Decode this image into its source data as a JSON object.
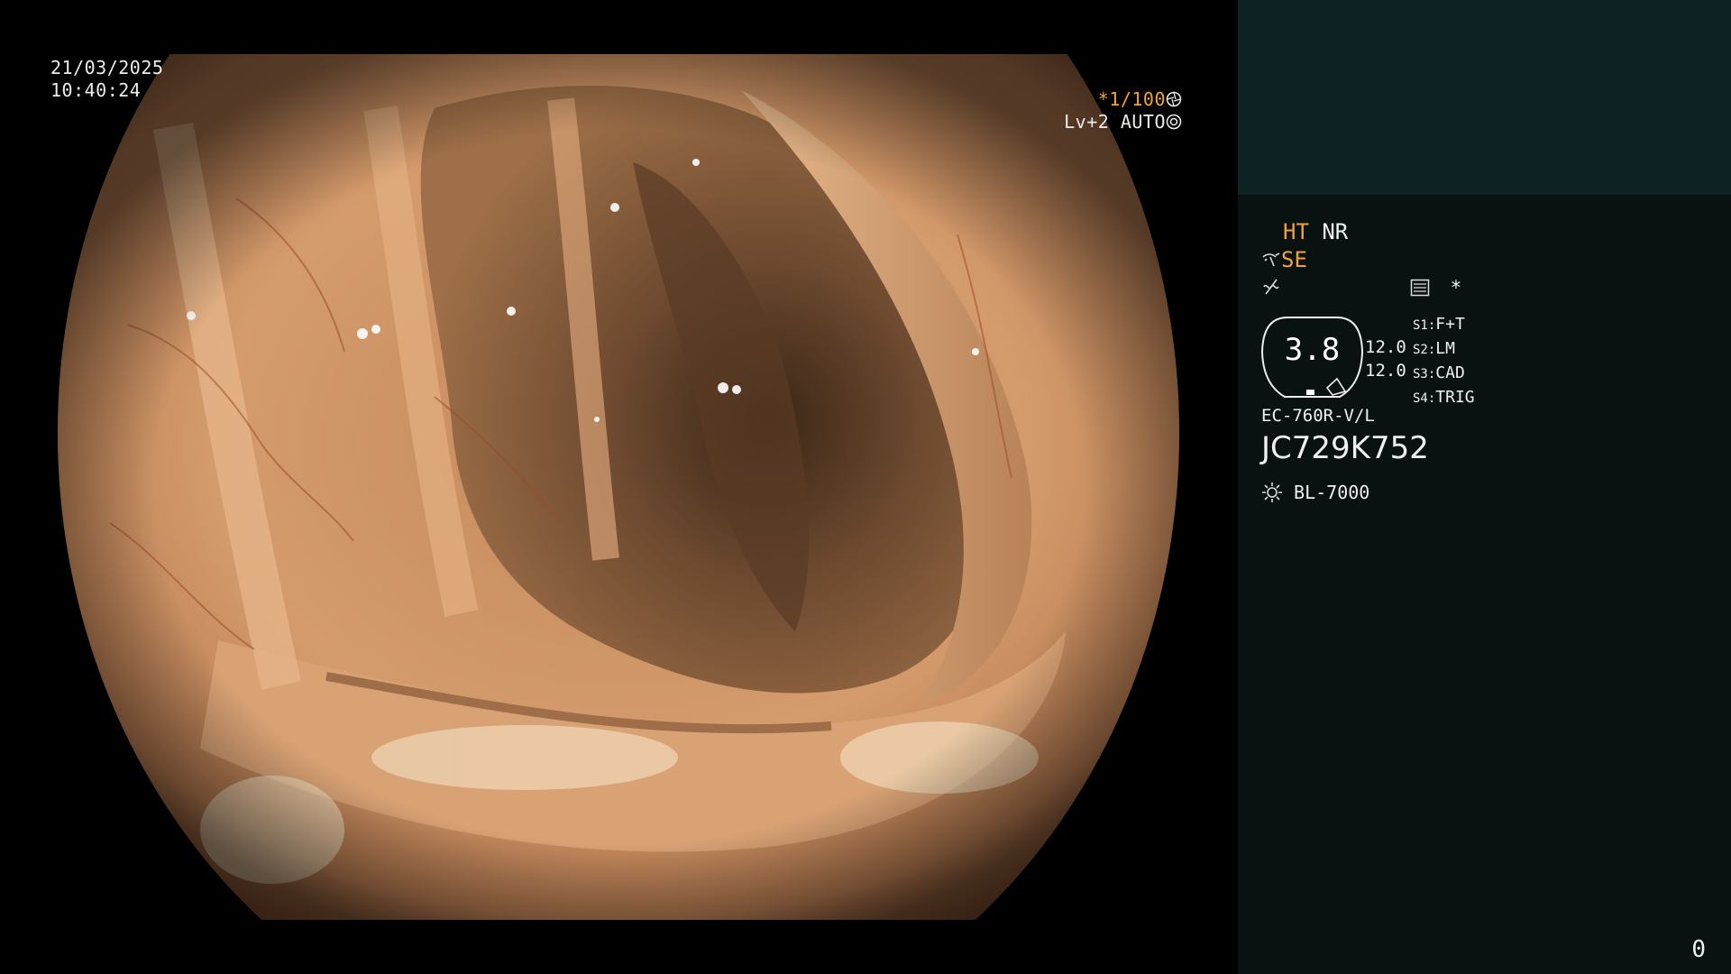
{
  "screen": {
    "date": "21/03/2025",
    "time": "10:40:24"
  },
  "shutter": {
    "speed": "*1/100",
    "speed_icon": "aperture-icon",
    "level": "Lv+2 AUTO",
    "level_icon": "auto-exposure-icon"
  },
  "panel": {
    "ht": "HT",
    "nr": "NR",
    "se": "SE",
    "se_icon": "fan-icon",
    "freeze_icon": "no-freeze-icon",
    "menu_icon": "document-icon",
    "star": "*",
    "zoom_value": "3.8",
    "params": [
      "12.0",
      "12.0"
    ],
    "scene_items": [
      {
        "key": "S1",
        "value": "F+T"
      },
      {
        "key": "S2",
        "value": "LM"
      },
      {
        "key": "S3",
        "value": "CAD"
      },
      {
        "key": "S4",
        "value": "TRIG"
      }
    ],
    "scope_model": "EC-760R-V/L",
    "scope_serial": "JC729K752",
    "light_icon": "sun-icon",
    "light_source": "BL-7000",
    "frame_counter": "0"
  },
  "colors": {
    "accent_orange": "#f0a23a",
    "panel_bg": "#0a1413",
    "panel_top": "#0d2323"
  }
}
